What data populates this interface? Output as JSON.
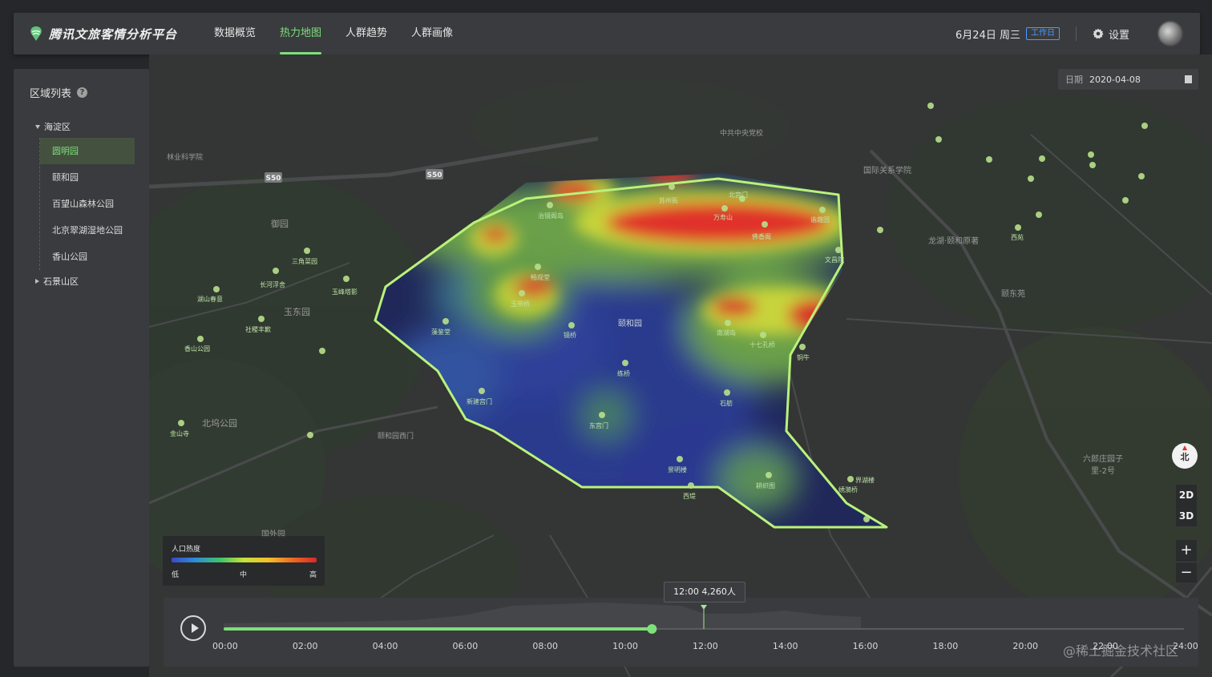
{
  "app": {
    "title": "腾讯文旅客情分析平台"
  },
  "nav": {
    "items": [
      {
        "label": "数据概览"
      },
      {
        "label": "热力地图"
      },
      {
        "label": "人群趋势"
      },
      {
        "label": "人群画像"
      }
    ]
  },
  "header": {
    "date": "6月24日 周三",
    "workday_badge": "工作日",
    "settings_label": "设置"
  },
  "sidebar": {
    "title": "区域列表",
    "groups": [
      {
        "label": "海淀区",
        "children": [
          {
            "label": "圆明园"
          },
          {
            "label": "颐和园"
          },
          {
            "label": "百望山森林公园"
          },
          {
            "label": "北京翠湖湿地公园"
          },
          {
            "label": "香山公园"
          }
        ]
      },
      {
        "label": "石景山区"
      }
    ]
  },
  "map": {
    "date_label": "日期",
    "date_value": "2020-04-08",
    "compass_label": "北",
    "view_2d": "2D",
    "view_3d": "3D",
    "zoom_in": "+",
    "zoom_out": "−",
    "legend": {
      "title": "人口热度",
      "low": "低",
      "mid": "中",
      "high": "高"
    },
    "labels": [
      {
        "text": "林业科学院"
      },
      {
        "text": "御园"
      },
      {
        "text": "玉东园"
      },
      {
        "text": "北坞公园"
      },
      {
        "text": "颐和园西门"
      },
      {
        "text": "中共中央党校"
      },
      {
        "text": "国际关系学院"
      },
      {
        "text": "颐东苑"
      },
      {
        "text": "龙湖·颐和原著"
      },
      {
        "text": "六郎庄园子里-2号"
      },
      {
        "text": "国外园"
      },
      {
        "text": "颐和园"
      },
      {
        "text": "S50"
      },
      {
        "text": "S50"
      }
    ],
    "pois": [
      {
        "text": "北宫门"
      },
      {
        "text": "苏州街"
      },
      {
        "text": "万寿山"
      },
      {
        "text": "佛香阁"
      },
      {
        "text": "谐趣园"
      },
      {
        "text": "文昌院"
      },
      {
        "text": "十七孔桥"
      },
      {
        "text": "南湖岛"
      },
      {
        "text": "铜牛"
      },
      {
        "text": "练桥"
      },
      {
        "text": "镜桥"
      },
      {
        "text": "玉带桥"
      },
      {
        "text": "西堤"
      },
      {
        "text": "景明楼"
      },
      {
        "text": "耕织图"
      },
      {
        "text": "石舫"
      },
      {
        "text": "东宫门"
      },
      {
        "text": "新建宫门"
      },
      {
        "text": "藻鉴堂"
      },
      {
        "text": "畅观堂"
      },
      {
        "text": "治镜阁岛"
      },
      {
        "text": "界湖楼"
      },
      {
        "text": "绣漪桥"
      },
      {
        "text": "玉峰塔影"
      },
      {
        "text": "长河浮舍"
      },
      {
        "text": "三角菜园"
      },
      {
        "text": "社稷丰歉"
      },
      {
        "text": "湖山春意"
      },
      {
        "text": "香山公园"
      },
      {
        "text": "金山寺"
      },
      {
        "text": "西苑"
      }
    ]
  },
  "timeline": {
    "tooltip": "12:00  4,260人",
    "ticks": [
      "00:00",
      "02:00",
      "04:00",
      "06:00",
      "08:00",
      "10:00",
      "12:00",
      "14:00",
      "16:00",
      "18:00",
      "20:00",
      "22:00",
      "24:00"
    ],
    "progress": 0.446,
    "hover": 0.5
  },
  "watermark": "@稀土掘金技术社区",
  "colors": {
    "accent": "#7ee07a",
    "badge": "#4a9bff"
  }
}
